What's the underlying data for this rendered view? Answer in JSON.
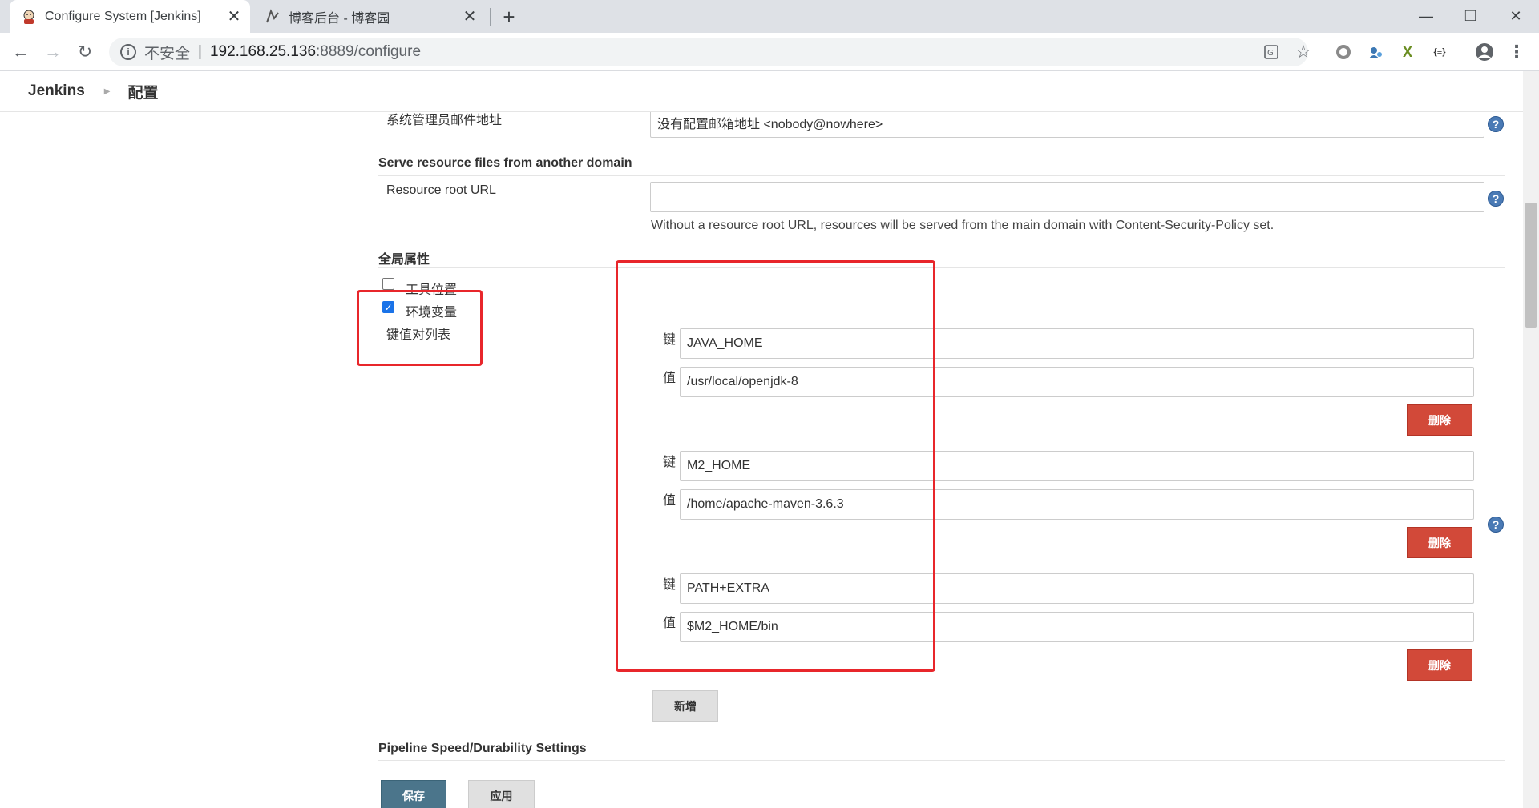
{
  "browser": {
    "tabs": [
      {
        "title": "Configure System [Jenkins]",
        "icon": "jenkins-icon"
      },
      {
        "title": "博客后台 - 博客园",
        "icon": "cnblogs-icon"
      }
    ],
    "address": {
      "security_label": "不安全",
      "separator": "|",
      "host": "192.168.25.136",
      "path": ":8889/configure"
    }
  },
  "breadcrumb": {
    "home": "Jenkins",
    "current": "配置"
  },
  "form": {
    "admin_email": {
      "label": "系统管理员邮件地址",
      "value": "没有配置邮箱地址 <nobody@nowhere>"
    },
    "resource_section": {
      "header": "Serve resource files from another domain",
      "field_label": "Resource root URL",
      "value": "",
      "hint": "Without a resource root URL, resources will be served from the main domain with Content-Security-Policy set."
    },
    "global_properties": {
      "header": "全局属性",
      "tool_locations_label": "工具位置",
      "tool_locations_checked": false,
      "env_vars_label": "环境变量",
      "env_vars_checked": true,
      "kv_list_label": "键值对列表",
      "key_label": "键",
      "value_label": "值",
      "delete_label": "删除",
      "add_label": "新增",
      "entries": [
        {
          "key": "JAVA_HOME",
          "value": "/usr/local/openjdk-8"
        },
        {
          "key": "M2_HOME",
          "value": "/home/apache-maven-3.6.3"
        },
        {
          "key": "PATH+EXTRA",
          "value": "$M2_HOME/bin"
        }
      ]
    },
    "pipeline_section": {
      "header": "Pipeline Speed/Durability Settings"
    },
    "buttons": {
      "save": "保存",
      "apply": "应用"
    }
  },
  "colors": {
    "delete_button": "#d24939",
    "save_button": "#4b758b",
    "annotation_box": "#e8262b",
    "help_icon": "#4a7ab5"
  }
}
